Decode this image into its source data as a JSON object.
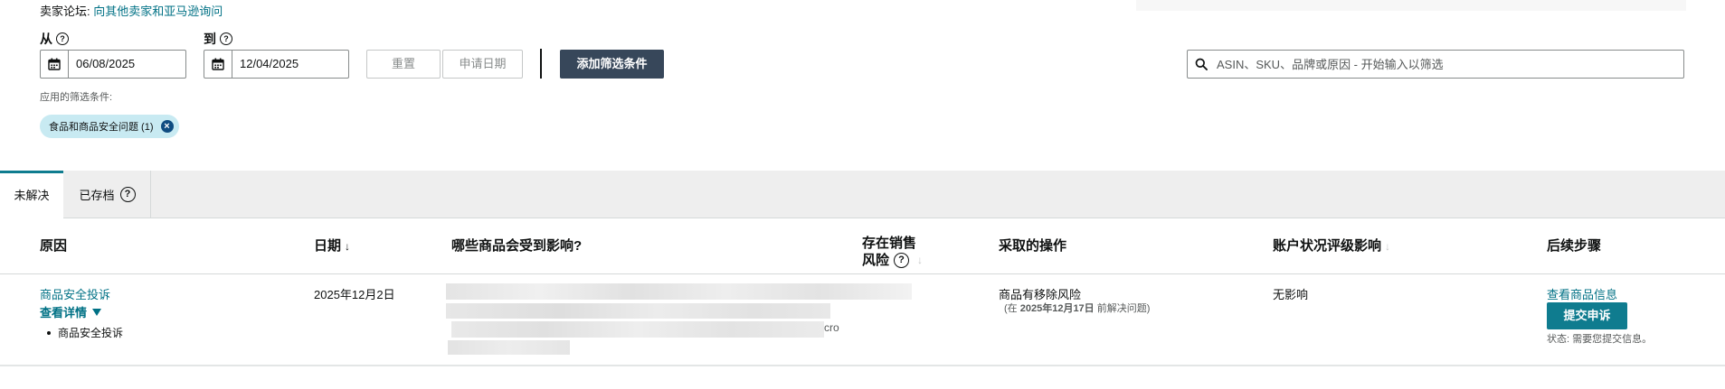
{
  "header": {
    "forum_label": "卖家论坛:",
    "forum_link": "向其他卖家和亚马逊询问"
  },
  "filters": {
    "from_label": "从",
    "to_label": "到",
    "from_value": "06/08/2025",
    "to_value": "12/04/2025",
    "reset_label": "重置",
    "request_date_label": "申请日期",
    "add_filter_label": "添加筛选条件",
    "search_placeholder": "ASIN、SKU、品牌或原因 - 开始输入以筛选",
    "applied_label": "应用的筛选条件:",
    "chip_label": "食品和商品安全问题 (1)"
  },
  "tabs": [
    {
      "label": "未解决",
      "active": true
    },
    {
      "label": "已存档",
      "active": false
    }
  ],
  "table": {
    "headers": {
      "reason": "原因",
      "date": "日期",
      "affected": "哪些商品会受到影响?",
      "risk_line1": "存在销售",
      "risk_line2": "风险",
      "action": "采取的操作",
      "health": "账户状况评级影响",
      "next": "后续步骤"
    },
    "rows": [
      {
        "reason": "商品安全投诉",
        "details_link": "查看详情",
        "bullet": "商品安全投诉",
        "date": "2025年12月2日",
        "affected_suffix": "cro",
        "action": "商品有移除风险",
        "action_sub_prefix": "(在 ",
        "action_sub_date": "2025年12月17日",
        "action_sub_suffix": " 前解决问题)",
        "health": "无影响",
        "next_link": "查看商品信息",
        "submit_label": "提交申诉",
        "status": "状态:  需要您提交信息。"
      }
    ]
  },
  "icons": {
    "calendar": "calendar-icon",
    "help": "help-icon",
    "search": "search-icon",
    "close": "close-icon"
  },
  "colors": {
    "link": "#007185",
    "dark_button": "#37475a",
    "primary_button": "#0f7c8f",
    "chip_bg": "#c8eaf2"
  }
}
